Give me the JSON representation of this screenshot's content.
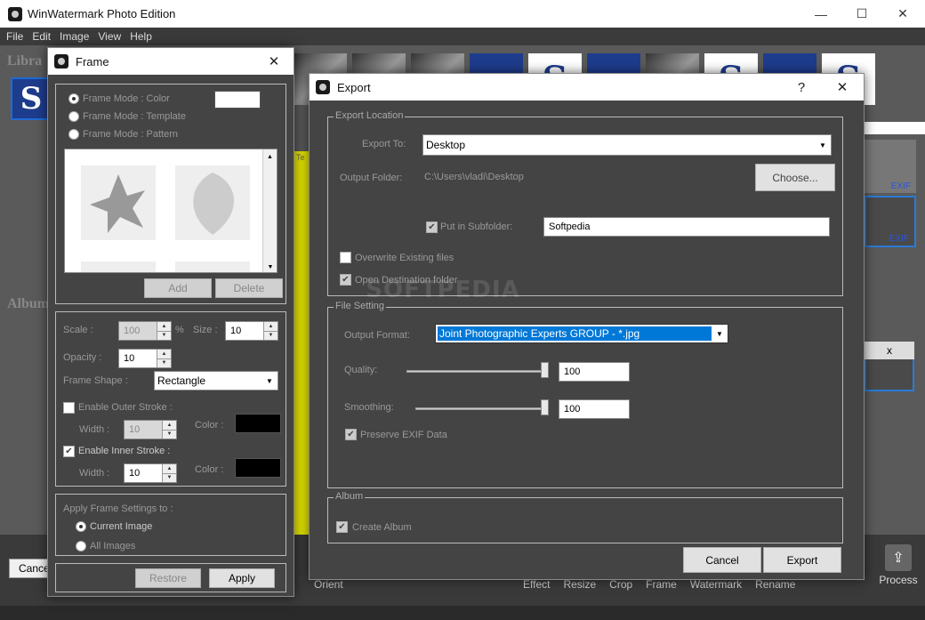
{
  "app": {
    "title": "WinWatermark Photo Edition",
    "icon": "camera-icon"
  },
  "window_controls": {
    "minimize": "—",
    "maximize": "☐",
    "close": "✕"
  },
  "menu": [
    "File",
    "Edit",
    "Image",
    "View",
    "Help"
  ],
  "background": {
    "library_label": "Libra",
    "album_label": "Album",
    "exif_label_1": "EXIF",
    "exif_label_2": "EXIF",
    "x_label": "x",
    "cancel_label": "Cancel",
    "orient_label": "Orient",
    "tools": [
      "Effect",
      "Resize",
      "Crop",
      "Frame",
      "Watermark",
      "Rename"
    ],
    "process_label": "Process",
    "yellow_text": "Te"
  },
  "frame_dialog": {
    "title": "Frame",
    "close": "✕",
    "mode_color": "Frame Mode : Color",
    "mode_template": "Frame Mode : Template",
    "mode_pattern": "Frame Mode : Pattern",
    "add_label": "Add",
    "delete_label": "Delete",
    "scale_label": "Scale :",
    "scale_value": "100",
    "percent": "%",
    "size_label": "Size :",
    "size_value": "10",
    "opacity_label": "Opacity :",
    "opacity_value": "10",
    "shape_label": "Frame Shape :",
    "shape_value": "Rectangle",
    "outer_stroke_label": "Enable Outer Stroke :",
    "outer_width_label": "Width :",
    "outer_width_value": "10",
    "outer_color_label": "Color :",
    "inner_stroke_label": "Enable Inner Stroke :",
    "inner_width_label": "Width :",
    "inner_width_value": "10",
    "inner_color_label": "Color :",
    "apply_to_label": "Apply Frame Settings to :",
    "current_image": "Current Image",
    "all_images": "All Images",
    "restore_label": "Restore",
    "apply_label": "Apply",
    "colors": {
      "frame_color": "#ffffff",
      "outer_color": "#000000",
      "inner_color": "#000000"
    }
  },
  "export_dialog": {
    "title": "Export",
    "help": "?",
    "close": "✕",
    "location_group": "Export Location",
    "export_to_label": "Export To:",
    "export_to_value": "Desktop",
    "output_folder_label": "Output Folder:",
    "output_folder_value": "C:\\Users\\vladi\\Desktop",
    "choose_label": "Choose...",
    "subfolder_label": "Put in Subfolder:",
    "subfolder_value": "Softpedia",
    "overwrite_label": "Overwrite Existing files",
    "open_dest_label": "Open Destination folder",
    "file_group": "File Setting",
    "format_label": "Output Format:",
    "format_value": "Joint Photographic Experts GROUP - *.jpg",
    "quality_label": "Quality:",
    "quality_value": "100",
    "smoothing_label": "Smoothing:",
    "smoothing_value": "100",
    "exif_label": "Preserve EXIF Data",
    "album_group": "Album",
    "create_album_label": "Create Album",
    "cancel_label": "Cancel",
    "export_label": "Export",
    "watermark": "SOFTPEDIA",
    "colors": {
      "select_highlight": "#0078d7"
    }
  }
}
